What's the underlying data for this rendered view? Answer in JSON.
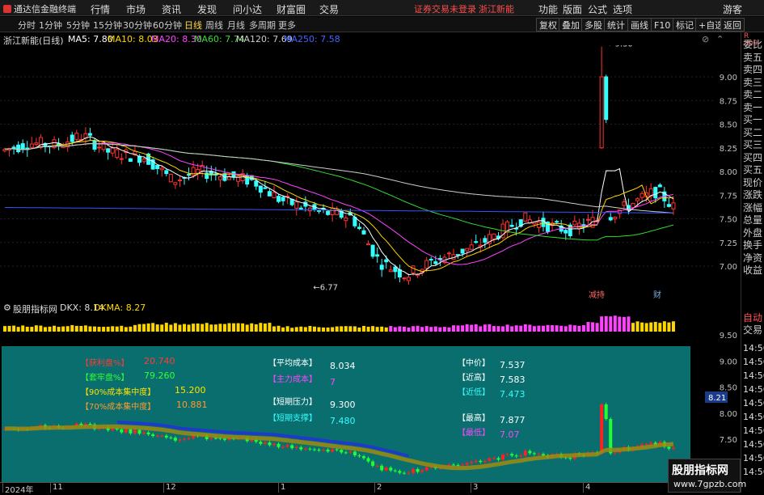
{
  "app": {
    "title": "通达信金融终端",
    "menu": [
      "行情",
      "市场",
      "资讯",
      "发现",
      "问小达",
      "财富圈",
      "交易"
    ],
    "warning": "证券交易未登录",
    "stock_short": "浙江新能",
    "right_menu": [
      "功能",
      "版面",
      "公式",
      "选项"
    ],
    "guest": "游客"
  },
  "toolbar": {
    "periods": [
      "分时",
      "1分钟",
      "5分钟",
      "15分钟",
      "30分钟",
      "60分钟",
      "日线",
      "周线",
      "月线",
      "多周期",
      "更多"
    ],
    "active": "日线",
    "buttons": [
      "复权",
      "叠加",
      "多股",
      "统计",
      "画线",
      "F10",
      "标记",
      "+自选",
      "返回"
    ]
  },
  "title": {
    "name": "浙江新能(日线)",
    "ma": [
      {
        "label": "MA5: 7.80",
        "color": "#ffffff"
      },
      {
        "label": "MA10: 8.03",
        "color": "#ffd700"
      },
      {
        "label": "MA20: 8.30",
        "color": "#ff44ff"
      },
      {
        "label": "MA60: 7.74",
        "color": "#33dd33"
      },
      {
        "label": "MA120: 7.69",
        "color": "#cccccc"
      },
      {
        "label": "MA250: 7.58",
        "color": "#4466ff"
      }
    ]
  },
  "price_axis": [
    "9.00",
    "8.75",
    "8.50",
    "8.25",
    "8.00",
    "7.75",
    "7.50",
    "7.25",
    "7.00"
  ],
  "annotations": {
    "high": "9.30",
    "low": "6.77",
    "flag1": "减持",
    "flag2": "财"
  },
  "indicator": {
    "name": "股朋指标网",
    "dkx": "DKX: 8.14",
    "dkma": "DKMA: 8.27"
  },
  "lower_axis": [
    "9.50",
    "9.00",
    "8.50",
    "8.00",
    "7.50"
  ],
  "current_price_tag": "8.21",
  "overlay": {
    "rows": [
      {
        "label": "【获利盘%】",
        "value": "20.740",
        "lc": "#ff3b3b",
        "vc": "#ff3b3b"
      },
      {
        "label": "【套牢盘%】",
        "value": "79.260",
        "lc": "#33ff33",
        "vc": "#33ff33"
      },
      {
        "label": "【90%成本集中度】",
        "value": "15.200",
        "lc": "#ffe000",
        "vc": "#ffe000"
      },
      {
        "label": "【70%成本集中度】",
        "value": "10.881",
        "lc": "#ff9a2e",
        "vc": "#ff9a2e"
      }
    ],
    "mid": [
      {
        "label": "【平均成本】",
        "value": "8.034",
        "lc": "#ffffff",
        "vc": "#ffffff"
      },
      {
        "label": "【主力成本】",
        "value": "7",
        "lc": "#ff44ff",
        "vc": "#ff44ff"
      },
      {
        "label": "【短期压力】",
        "value": "9.300",
        "lc": "#ffffff",
        "vc": "#ffffff"
      },
      {
        "label": "【短期支撑】",
        "value": "7.480",
        "lc": "#33ffff",
        "vc": "#33ffff"
      }
    ],
    "right": [
      {
        "label": "【中价】",
        "value": "7.537",
        "lc": "#ffffff",
        "vc": "#ffffff"
      },
      {
        "label": "【近高】",
        "value": "7.583",
        "lc": "#ffffff",
        "vc": "#ffffff"
      },
      {
        "label": "【近低】",
        "value": "7.473",
        "lc": "#33ffff",
        "vc": "#33ffff"
      },
      {
        "label": "【最高】",
        "value": "7.877",
        "lc": "#ffffff",
        "vc": "#ffffff"
      },
      {
        "label": "【最低】",
        "value": "7.07",
        "lc": "#ff44ff",
        "vc": "#ff44ff"
      }
    ]
  },
  "date_axis": [
    {
      "label": "2024年",
      "pos": 0.003
    },
    {
      "label": "11",
      "pos": 0.068
    },
    {
      "label": "12",
      "pos": 0.22
    },
    {
      "label": "1",
      "pos": 0.376
    },
    {
      "label": "2",
      "pos": 0.505
    },
    {
      "label": "3",
      "pos": 0.635
    },
    {
      "label": "4",
      "pos": 0.787
    }
  ],
  "right_panel": [
    "委比",
    "卖五",
    "卖四",
    "卖三",
    "卖二",
    "卖一",
    "买一",
    "买二",
    "买三",
    "买四",
    "买五",
    "现价",
    "涨跌",
    "涨幅",
    "总量",
    "外盘",
    "换手",
    "净资",
    "收益"
  ],
  "right_panel_bottom": [
    "自动",
    "交易"
  ],
  "times": [
    "14:56",
    "14:56",
    "14:56",
    "14:56",
    "14:56",
    "14:56",
    "14:56",
    "14:56",
    "14:56",
    "14:56"
  ],
  "watermark": {
    "line1": "股朋指标网",
    "line2": "www.7gpzb.com"
  },
  "colors": {
    "up": "#ff3030",
    "down": "#33ffff",
    "teal": "#0a6e6e"
  }
}
